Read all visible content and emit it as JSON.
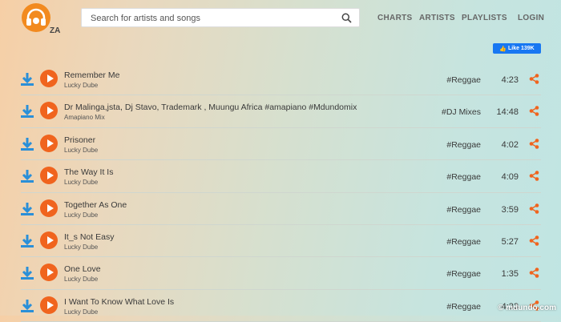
{
  "header": {
    "country": "ZA",
    "search_placeholder": "Search for artists and songs",
    "nav": [
      "CHARTS",
      "ARTISTS",
      "PLAYLISTS",
      "LOGIN"
    ]
  },
  "fb_like": {
    "label": "Like",
    "count": "139K"
  },
  "songs": [
    {
      "title": "Remember Me",
      "artist": "Lucky Dube",
      "genre": "#Reggae",
      "duration": "4:23"
    },
    {
      "title": "Dr Malinga,jsta, Dj Stavo, Trademark , Muungu Africa #amapiano #Mdundomix",
      "artist": "Amapiano Mix",
      "genre": "#DJ Mixes",
      "duration": "14:48"
    },
    {
      "title": "Prisoner",
      "artist": "Lucky Dube",
      "genre": "#Reggae",
      "duration": "4:02"
    },
    {
      "title": "The Way It Is",
      "artist": "Lucky Dube",
      "genre": "#Reggae",
      "duration": "4:09"
    },
    {
      "title": "Together As One",
      "artist": "Lucky Dube",
      "genre": "#Reggae",
      "duration": "3:59"
    },
    {
      "title": "It_s Not Easy",
      "artist": "Lucky Dube",
      "genre": "#Reggae",
      "duration": "5:27"
    },
    {
      "title": "One Love",
      "artist": "Lucky Dube",
      "genre": "#Reggae",
      "duration": "1:35"
    },
    {
      "title": "I Want To Know What Love Is",
      "artist": "Lucky Dube",
      "genre": "#Reggae",
      "duration": "4:33"
    }
  ],
  "watermark": "© mdundo.com",
  "colors": {
    "accent": "#f0641e",
    "download": "#2a8fd8",
    "fb": "#1877f2"
  }
}
